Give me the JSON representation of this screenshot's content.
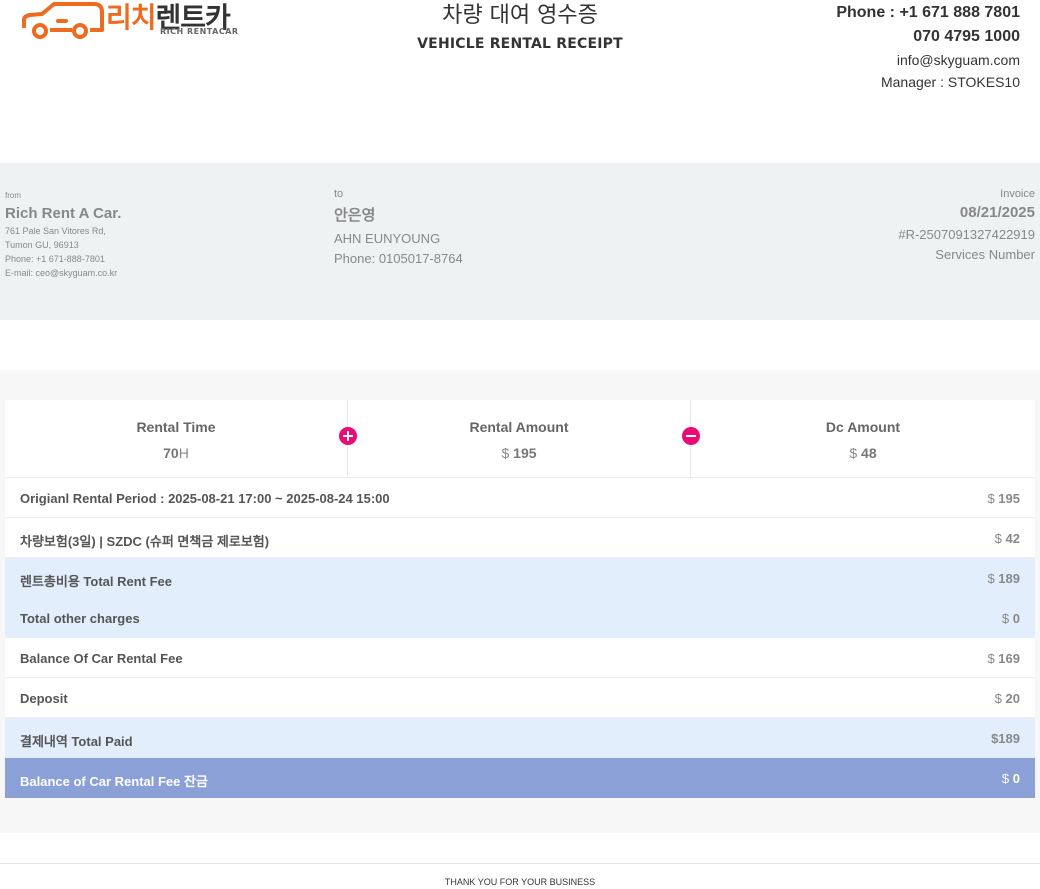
{
  "header": {
    "logo_ko_orange": "리치",
    "logo_ko_dark": "렌트카",
    "logo_sub": "RICH RENTACAR",
    "title_ko": "차량 대여 영수증",
    "title_en": "VEHICLE RENTAL RECEIPT",
    "phone1": "Phone : +1 671 888 7801",
    "phone2": "070 4795 1000",
    "email": "info@skyguam.com",
    "manager": "Manager : STOKES10"
  },
  "from": {
    "label": "from",
    "name": "Rich Rent A Car.",
    "address1": "761 Pale San Vitores Rd,",
    "address2": "Tumon GU, 96913",
    "phone": "Phone: +1 671-888-7801",
    "email": "E-mail: ceo@skyguam.co.kr"
  },
  "to": {
    "label": "to",
    "name_ko": "안은영",
    "name_en": "AHN EUNYOUNG",
    "phone": "Phone: 0105017-8764"
  },
  "invoice": {
    "label": "Invoice",
    "date": "08/21/2025",
    "number": "#R-2507091327422919",
    "services": "Services Number"
  },
  "summary": {
    "rental_time_label": "Rental Time",
    "rental_time_value": "70",
    "rental_time_unit": "H",
    "rental_amount_label": "Rental Amount",
    "rental_amount_currency": "$",
    "rental_amount_value": "195",
    "dc_amount_label": "Dc Amount",
    "dc_amount_currency": "$",
    "dc_amount_value": "48"
  },
  "rows": [
    {
      "label": "Origianl Rental Period : 2025-08-21 17:00 ~ 2025-08-24 15:00",
      "currency": "$",
      "value": "195"
    },
    {
      "label": "차량보험(3일) | SZDC (슈퍼 면책금 제로보험)",
      "currency": "$",
      "value": "42"
    },
    {
      "label": "렌트총비용 Total Rent Fee",
      "currency": "$",
      "value": "189"
    },
    {
      "label": "Total other charges",
      "currency": "$",
      "value": "0"
    },
    {
      "label": "Balance Of Car Rental Fee",
      "currency": "$",
      "value": "169"
    },
    {
      "label": "Deposit",
      "currency": "$",
      "value": "20"
    },
    {
      "label": "결제내역 Total Paid",
      "currency": "",
      "value": "$189"
    },
    {
      "label": "Balance of Car Rental Fee 잔금",
      "currency": "$",
      "value": "0"
    }
  ],
  "footer": {
    "text": "THANK YOU FOR YOUR BUSINESS"
  },
  "colors": {
    "brand_orange": "#ee6a1f",
    "accent_pink": "#ec0a75",
    "row_blue": "#e3eefc",
    "row_dark": "#8aa0d6"
  }
}
